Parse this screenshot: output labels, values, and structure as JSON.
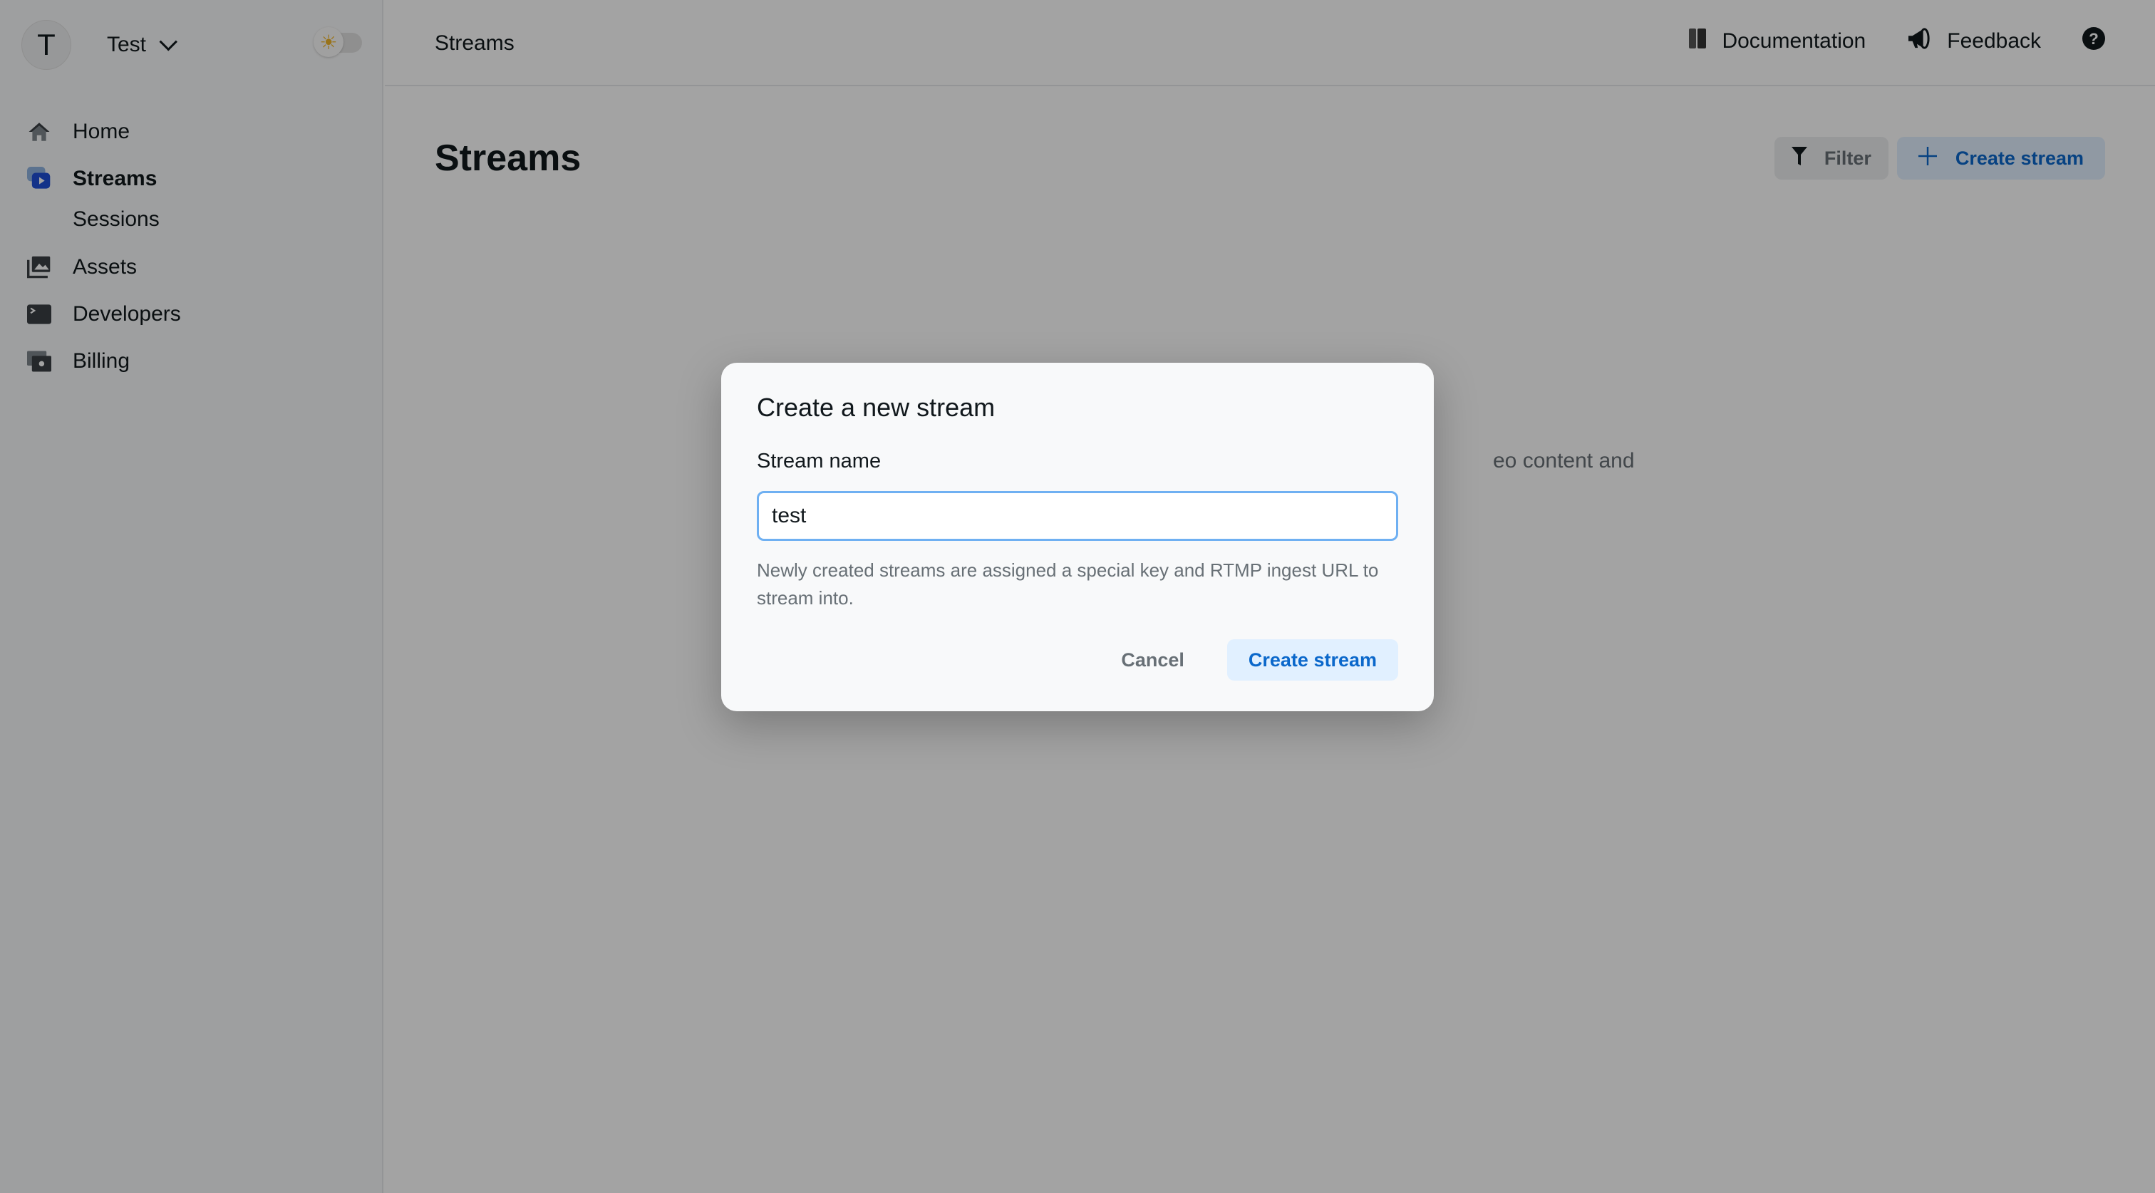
{
  "sidebar": {
    "account": {
      "initial": "T",
      "name": "Test"
    },
    "theme_toggle_icon": "sun-icon",
    "items": [
      {
        "label": "Home",
        "icon": "home-icon"
      },
      {
        "label": "Streams",
        "icon": "streams-icon",
        "active": true
      },
      {
        "label": "Sessions"
      },
      {
        "label": "Assets",
        "icon": "assets-icon"
      },
      {
        "label": "Developers",
        "icon": "terminal-icon"
      },
      {
        "label": "Billing",
        "icon": "billing-icon"
      }
    ]
  },
  "header": {
    "breadcrumb": "Streams",
    "links": [
      {
        "label": "Documentation",
        "icon": "book-icon"
      },
      {
        "label": "Feedback",
        "icon": "megaphone-icon"
      }
    ],
    "help_icon": "help-icon"
  },
  "main": {
    "title": "Streams",
    "filter_label": "Filter",
    "create_label": "Create stream",
    "background_text_fragment": "eo content and"
  },
  "dialog": {
    "title": "Create a new stream",
    "field_label": "Stream name",
    "field_value": "test",
    "help_text": "Newly created streams are assigned a special key and RTMP ingest URL to stream into.",
    "cancel_label": "Cancel",
    "create_label": "Create stream"
  },
  "colors": {
    "accent": "#0b68cb",
    "accent_bg": "#e1f0ff",
    "streams_icon": "#1e4fd6",
    "sun": "#f0b429"
  }
}
